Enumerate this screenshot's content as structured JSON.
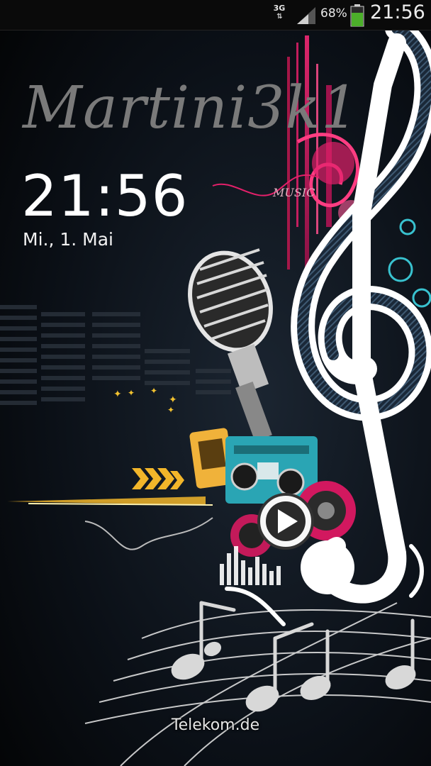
{
  "status_bar": {
    "network_type": "3G",
    "network_arrows": "⇅",
    "battery_percent": "68%",
    "time": "21:56",
    "signal_icon": "signal-strength-icon",
    "battery_icon": "battery-icon",
    "battery_color": "#4caf2a"
  },
  "lockscreen": {
    "owner_info": "Martini3k1",
    "clock": "21:56",
    "date": "Mi., 1. Mai",
    "carrier": "Telekom.de"
  },
  "wallpaper": {
    "treble_clef_text": "MUSIC",
    "accent_colors": [
      "#e21e6f",
      "#2bb3c0",
      "#f2c230",
      "#ffffff"
    ]
  }
}
